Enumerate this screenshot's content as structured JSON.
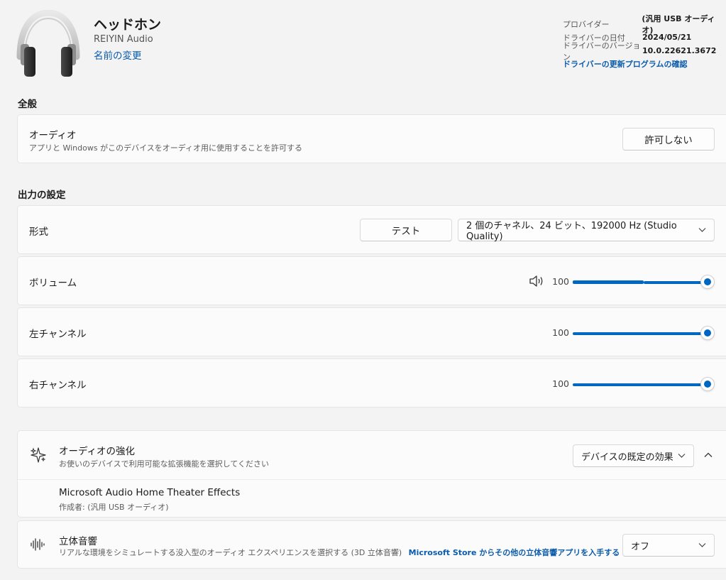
{
  "device": {
    "title": "ヘッドホン",
    "manufacturer": "REIYIN Audio",
    "rename_link": "名前の変更",
    "icon": "headphones-icon"
  },
  "driver": {
    "rows": [
      {
        "key": "プロバイダー",
        "value": "(汎用 USB オーディオ)"
      },
      {
        "key": "ドライバーの日付",
        "value": "2024/05/21"
      },
      {
        "key": "ドライバーのバージョン",
        "value": "10.0.22621.3672"
      }
    ],
    "update_link": "ドライバーの更新プログラムの確認"
  },
  "general": {
    "heading": "全般",
    "audio": {
      "title": "オーディオ",
      "description": "アプリと Windows がこのデバイスをオーディオ用に使用することを許可する",
      "button": "許可しない"
    }
  },
  "output": {
    "heading": "出力の設定",
    "format": {
      "title": "形式",
      "test_button": "テスト",
      "selected": "2 個のチャネル、24 ビット、192000 Hz (Studio Quality)"
    },
    "volume": {
      "title": "ボリューム",
      "value": "100",
      "level": 1.0,
      "icon": "speaker-icon"
    },
    "left_channel": {
      "title": "左チャンネル",
      "value": "100",
      "level": 1.0
    },
    "right_channel": {
      "title": "右チャンネル",
      "value": "100",
      "level": 1.0
    }
  },
  "enhancements": {
    "title": "オーディオの強化",
    "description": "お使いのデバイスで利用可能な拡張機能を選択してください",
    "selected": "デバイスの既定の効果",
    "icon": "sparkle-icon",
    "effect": {
      "name": "Microsoft Audio Home Theater Effects",
      "author": "作成者: (汎用 USB オーディオ)"
    }
  },
  "spatial": {
    "title": "立体音響",
    "description": "リアルな環境をシミュレートする没入型のオーディオ エクスペリエンスを選択する (3D 立体音響)",
    "store_link": "Microsoft Store からその他の立体音響アプリを入手する",
    "selected": "オフ",
    "icon": "soundwave-icon"
  },
  "colors": {
    "accent": "#0067c0",
    "link": "#0b5cab",
    "background": "#f3f3f3",
    "card": "#fbfbfb"
  }
}
